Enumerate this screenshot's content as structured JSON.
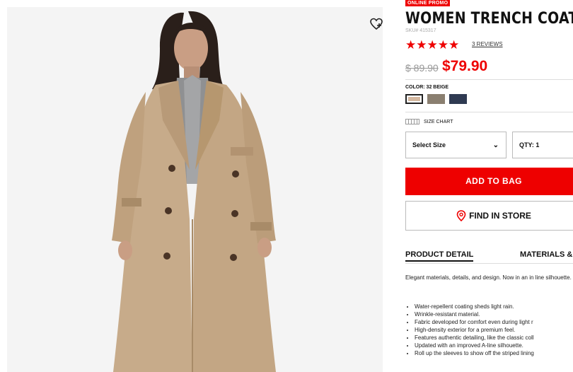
{
  "product": {
    "promo_badge": "ONLINE PROMO",
    "title": "WOMEN TRENCH COAT",
    "sku": "SKU# 415317",
    "rating_stars": 5,
    "reviews_label": "3 REVIEWS",
    "price_original": "$ 89.90",
    "price_sale": "$79.90",
    "color_label": "COLOR: 32 BEIGE",
    "swatches": [
      {
        "name": "beige",
        "color": "#d4b8a0",
        "selected": true
      },
      {
        "name": "gray-brown",
        "color": "#8a7f70",
        "selected": false
      },
      {
        "name": "navy",
        "color": "#2f3a52",
        "selected": false
      }
    ],
    "size_chart_label": "SIZE CHART",
    "size_select_label": "Select Size",
    "qty_label": "QTY: 1",
    "add_to_bag_label": "ADD TO BAG",
    "find_in_store_label": "FIND IN STORE"
  },
  "tabs": {
    "detail_label": "PRODUCT DETAIL",
    "materials_label": "MATERIALS &"
  },
  "description": {
    "intro": "Elegant materials, details, and design. Now in an in line silhouette.",
    "bullets": [
      "Water-repellent coating sheds light rain.",
      "Wrinkle-resistant material.",
      "Fabric developed for comfort even during light r",
      "High-density exterior for a premium feel.",
      "Features authentic detailing, like the classic coll",
      "Updated with an improved A-line silhouette.",
      "Roll up the sleeves to show off the striped lining"
    ]
  },
  "icons": {
    "wishlist": "heart-plus-icon",
    "select_arrow": "chevron-down-icon",
    "store": "location-pin-icon",
    "size_chart": "ruler-icon"
  },
  "colors": {
    "accent": "#e60012",
    "coat": "#c7ab8a",
    "background": "#f4f4f4"
  }
}
